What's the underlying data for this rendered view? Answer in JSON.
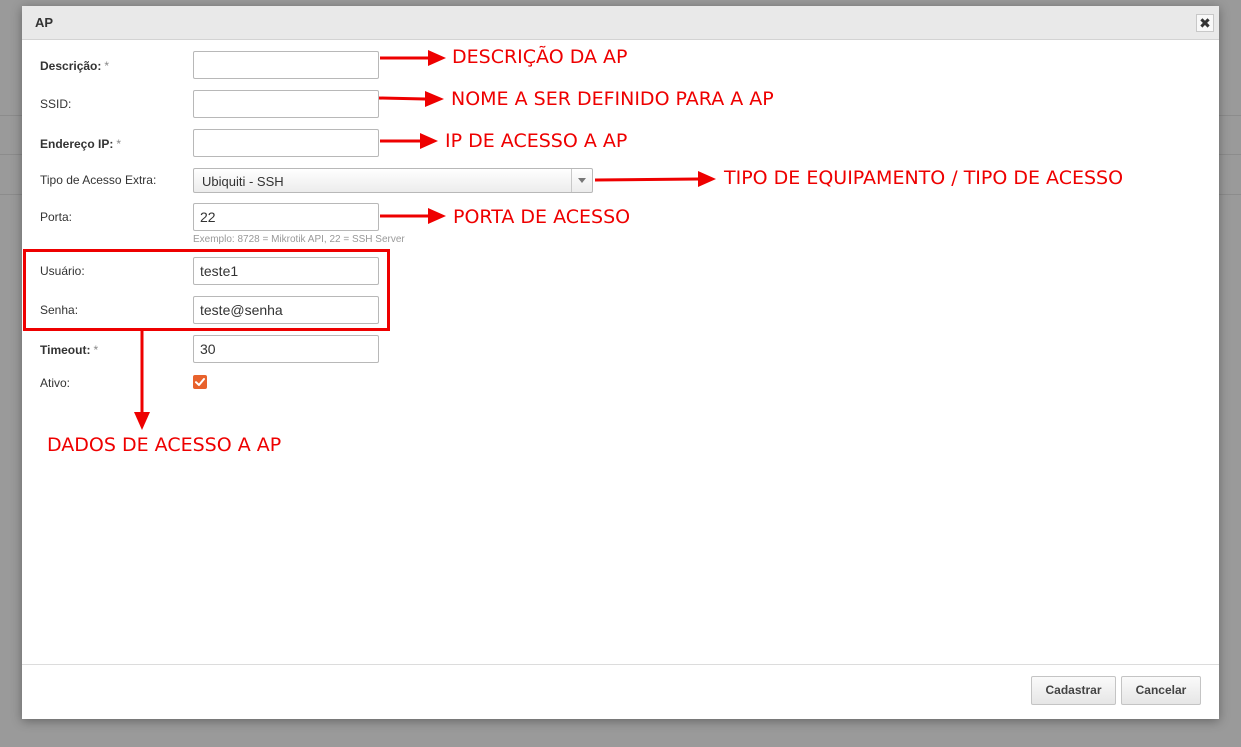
{
  "modal": {
    "title": "AP",
    "close_glyph": "✖",
    "required_marker": "*"
  },
  "form": {
    "descricao": {
      "label": "Descrição:",
      "value": ""
    },
    "ssid": {
      "label": "SSID:",
      "value": ""
    },
    "endereco_ip": {
      "label": "Endereço IP:",
      "value": ""
    },
    "tipo_acesso": {
      "label": "Tipo de Acesso Extra:",
      "selected": "Ubiquiti - SSH"
    },
    "porta": {
      "label": "Porta:",
      "value": "22",
      "hint": "Exemplo: 8728 = Mikrotik API, 22 = SSH Server"
    },
    "usuario": {
      "label": "Usuário:",
      "value": "teste1"
    },
    "senha": {
      "label": "Senha:",
      "value": "teste@senha"
    },
    "timeout": {
      "label": "Timeout:",
      "value": "30"
    },
    "ativo": {
      "label": "Ativo:",
      "checked": true,
      "check_glyph": "✓"
    }
  },
  "buttons": {
    "cadastrar": "Cadastrar",
    "cancelar": "Cancelar"
  },
  "annotations": {
    "descricao": "DESCRIÇÃO DA AP",
    "ssid": "NOME A SER DEFINIDO PARA A AP",
    "ip": "IP DE ACESSO A AP",
    "tipo": "TIPO DE EQUIPAMENTO / TIPO DE ACESSO",
    "porta": "PORTA DE ACESSO",
    "dados": "DADOS DE ACESSO A AP",
    "color": "#ee0000"
  },
  "colors": {
    "overlay": "#9a9a9a",
    "header": "#e9e9e9",
    "checkbox": "#e8622c"
  }
}
